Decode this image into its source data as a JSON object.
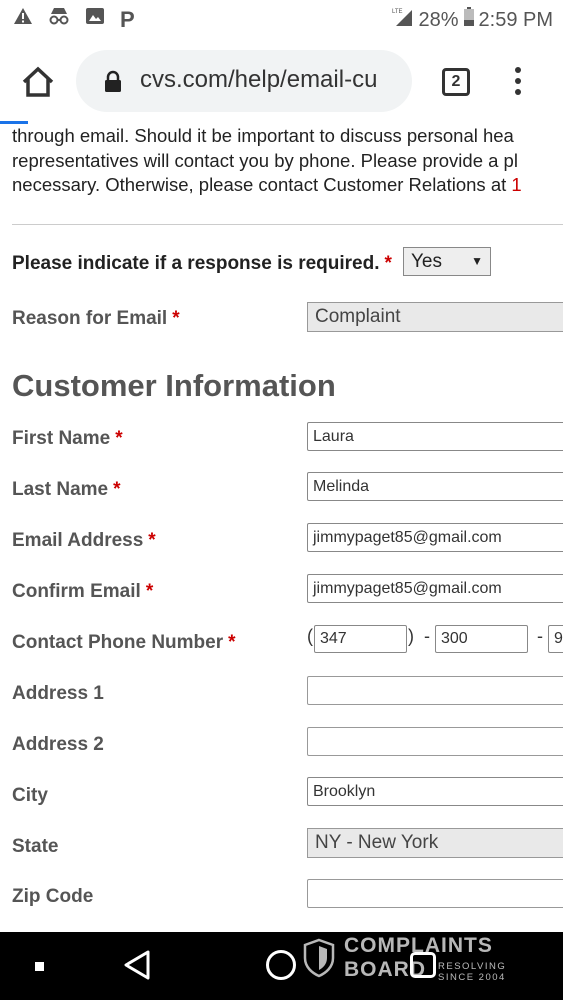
{
  "status_bar": {
    "signal_label": "LTE",
    "battery_percent": "28%",
    "time": "2:59 PM",
    "icons": [
      "warning-icon",
      "incognito-icon",
      "image-icon",
      "parking-icon",
      "signal-icon",
      "battery-icon"
    ]
  },
  "browser": {
    "url": "cvs.com/help/email-cu",
    "tab_count": "2"
  },
  "intro_lines": [
    "through email. Should it be important to discuss personal hea",
    "representatives will contact you by phone. Please provide a pl",
    "necessary. Otherwise, please contact Customer Relations at "
  ],
  "intro_phone_fragment": "1",
  "response": {
    "label": "Please indicate if a response is required.",
    "required_mark": "*",
    "value": "Yes"
  },
  "reason": {
    "label": "Reason for Email",
    "required_mark": "*",
    "value": "Complaint"
  },
  "section_title": "Customer Information",
  "fields": {
    "first_name": {
      "label": "First Name",
      "required_mark": "*",
      "value": "Laura"
    },
    "last_name": {
      "label": "Last Name",
      "required_mark": "*",
      "value": "Melinda"
    },
    "email": {
      "label": "Email Address",
      "required_mark": "*",
      "value": "jimmypaget85@gmail.com"
    },
    "confirm_email": {
      "label": "Confirm Email",
      "required_mark": "*",
      "value": "jimmypaget85@gmail.com"
    },
    "phone": {
      "label": "Contact Phone Number",
      "required_mark": "*",
      "open_paren": "(",
      "close_paren": ")",
      "separator": "-",
      "area": "347",
      "prefix": "300",
      "line": "9"
    },
    "address1": {
      "label": "Address 1",
      "value": ""
    },
    "address2": {
      "label": "Address 2",
      "value": ""
    },
    "city": {
      "label": "City",
      "value": "Brooklyn"
    },
    "state": {
      "label": "State",
      "value": "NY - New York"
    },
    "zip": {
      "label": "Zip Code",
      "value": ""
    }
  },
  "watermark": {
    "line1": "COMPLAINTS",
    "line2": "BOARD",
    "tag1": "RESOLVING",
    "tag2": "SINCE 2004"
  },
  "colors": {
    "required": "#cc0000",
    "label_grey": "#555555",
    "url_pill": "#f1f3f4",
    "accent_progress": "#1a73e8"
  }
}
